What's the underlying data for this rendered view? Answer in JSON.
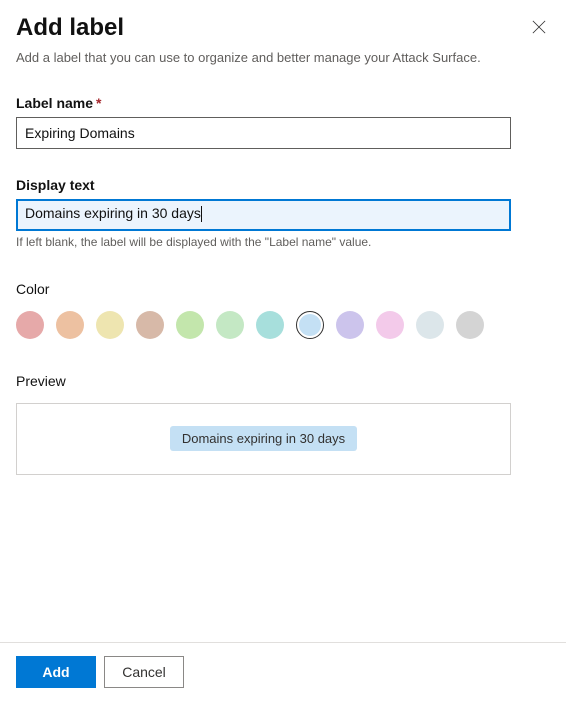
{
  "header": {
    "title": "Add label",
    "description": "Add a label that you can use to organize and better manage your Attack Surface."
  },
  "labelName": {
    "label": "Label name",
    "required": "*",
    "value": "Expiring Domains"
  },
  "displayText": {
    "label": "Display text",
    "value": "Domains expiring in 30 days",
    "helper": "If left blank, the label will be displayed with the \"Label name\" value."
  },
  "color": {
    "label": "Color",
    "selectedIndex": 7,
    "swatches": [
      "#e6a9a9",
      "#edc1a1",
      "#eee5b0",
      "#d7b9a8",
      "#c3e6ac",
      "#c4e8c4",
      "#a7dfdc",
      "#c4e0f4",
      "#ccc4ec",
      "#f3caea",
      "#dce6ea",
      "#d4d4d4"
    ]
  },
  "preview": {
    "label": "Preview",
    "chipText": "Domains expiring in 30 days",
    "chipColor": "#c4e0f4"
  },
  "footer": {
    "primary": "Add",
    "secondary": "Cancel"
  }
}
